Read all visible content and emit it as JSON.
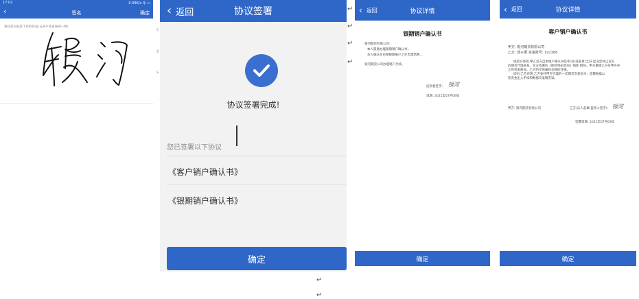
{
  "colors": {
    "primary": "#2f67c8",
    "text": "#222222",
    "muted": "#8a8a8a",
    "check_bg": "#3a6fd0"
  },
  "screen1": {
    "status_time": "17:02",
    "status_icons": "0.39K/s 令 ▭",
    "title": "签名",
    "confirm": "确定",
    "hint": "请在空白处签下您的签名(与开户签名保持一致)",
    "side_marks": [
      "c",
      "0",
      "s"
    ]
  },
  "screen2": {
    "back": "返回",
    "title": "协议签署",
    "success_text": "协议签署完成!",
    "signed_label": "您已签署以下协议",
    "agreements": [
      "《客户销户确认书》",
      "《银期销户确认书》"
    ],
    "confirm": "确定"
  },
  "screen3": {
    "back": "返回",
    "title": "协议详情",
    "doc_title": "银期销户确认书",
    "addressee": "银河期货有限公司:",
    "para1": "本人愿意办理银期销户确认书...",
    "para2": "本人确认在已销银期账户之外无需结算...",
    "footer_note": "银河期货公司办理销户手续。",
    "signer_label": "投资者签字:",
    "signature_text": "银河",
    "date_label": "日期:",
    "date": "2021年07月09日",
    "confirm": "确定"
  },
  "screen4": {
    "back": "返回",
    "title": "协议详情",
    "doc_title": "客户销户确认书",
    "party_a_label": "甲方:",
    "party_a": "银河期货有限公司",
    "party_b_label": "乙方:",
    "party_b": "郭子惠",
    "account_label": "资金账号:",
    "account_no": "102386",
    "body_lines": [
      "经友好协商,甲乙双方自本销户确认书签字(及/或盖章)之日 起决定终止双方",
      "的期货代理关系。双方签署的《期货经纪合同》随即 解除。甲方撤销乙方在甲方开",
      "立的资金账号。乙方的交易编码也随即注销。",
      "同时,乙方声明:乙方委托甲方代理的一切期货交易指令、结算数据以",
      "及资金出入手续和数据均准确无误。"
    ],
    "sign_a": "甲方: 银河期货有限公司",
    "sign_b": "乙方(法人盖章/自然人签字):",
    "signature_text": "银河",
    "sign_date_label": "签署日期:",
    "sign_date": "2021年07月09日",
    "confirm": "确定"
  },
  "marks": [
    "↵",
    "↵",
    "↵",
    "↵",
    "↵",
    "↵"
  ]
}
